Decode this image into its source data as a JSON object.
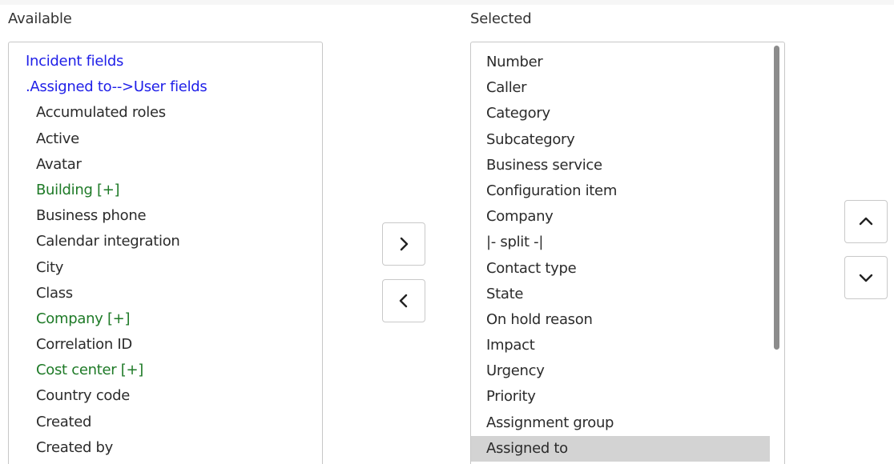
{
  "available": {
    "heading": "Available",
    "items": [
      {
        "label": "Incident fields",
        "kind": "group"
      },
      {
        "label": ".Assigned to-->User fields",
        "kind": "group"
      },
      {
        "label": "Accumulated roles",
        "kind": "field"
      },
      {
        "label": "Active",
        "kind": "field"
      },
      {
        "label": "Avatar",
        "kind": "field"
      },
      {
        "label": "Building [+]",
        "kind": "expand"
      },
      {
        "label": "Business phone",
        "kind": "field"
      },
      {
        "label": "Calendar integration",
        "kind": "field"
      },
      {
        "label": "City",
        "kind": "field"
      },
      {
        "label": "Class",
        "kind": "field"
      },
      {
        "label": "Company [+]",
        "kind": "expand"
      },
      {
        "label": "Correlation ID",
        "kind": "field"
      },
      {
        "label": "Cost center [+]",
        "kind": "expand"
      },
      {
        "label": "Country code",
        "kind": "field"
      },
      {
        "label": "Created",
        "kind": "field"
      },
      {
        "label": "Created by",
        "kind": "field"
      }
    ]
  },
  "selected": {
    "heading": "Selected",
    "items": [
      {
        "label": "Number"
      },
      {
        "label": "Caller"
      },
      {
        "label": "Category"
      },
      {
        "label": "Subcategory"
      },
      {
        "label": "Business service"
      },
      {
        "label": "Configuration item"
      },
      {
        "label": "Company"
      },
      {
        "label": "|- split -|"
      },
      {
        "label": "Contact type"
      },
      {
        "label": "State"
      },
      {
        "label": "On hold reason"
      },
      {
        "label": "Impact"
      },
      {
        "label": "Urgency"
      },
      {
        "label": "Priority"
      },
      {
        "label": "Assignment group"
      },
      {
        "label": "Assigned to",
        "selected": true
      }
    ]
  },
  "controls": {
    "add_icon": "chevron-right-icon",
    "remove_icon": "chevron-left-icon",
    "move_up_icon": "chevron-up-icon",
    "move_down_icon": "chevron-down-icon"
  },
  "colors": {
    "group_link": "#1f1fe8",
    "expandable": "#1e7a27",
    "selected_row": "#d3d3d3"
  }
}
